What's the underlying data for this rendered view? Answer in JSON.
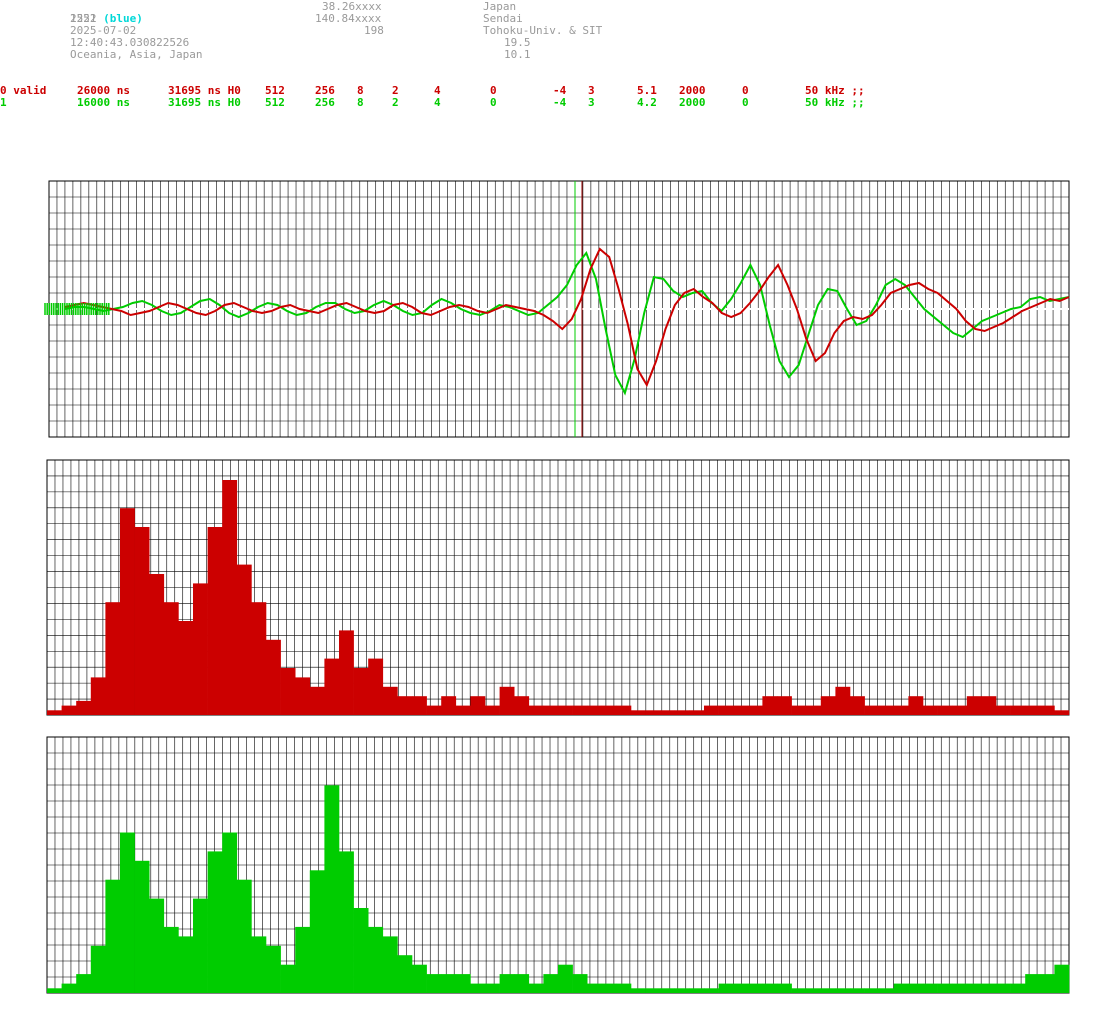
{
  "header": {
    "station_id": "2522",
    "station_color": "(blue)",
    "number": "1251",
    "date": "2025-07-02",
    "time": "12:40:43.030822526",
    "region": "Oceania, Asia, Japan",
    "lat": "38.26xxxx",
    "lon": "140.84xxxx",
    "alt": "198",
    "country": "Japan",
    "city": "Sendai",
    "org": "Tohoku-Univ. & SIT",
    "val1": "19.5",
    "val2": "10.1"
  },
  "channels": [
    {
      "id": "0 valid",
      "c1": "26000 ns",
      "c2": "31695 ns H0",
      "c3": "512",
      "c4": "256",
      "c5": "8",
      "c6": "2",
      "c7": "4",
      "c8": "0",
      "c9": "-4",
      "c10": "3",
      "c11": "5.1",
      "c12": "2000",
      "c13": "0",
      "c14": "50 kHz ;;",
      "color": "#cc0000"
    },
    {
      "id": "1",
      "c1": "16000 ns",
      "c2": "31695 ns H0",
      "c3": "512",
      "c4": "256",
      "c5": "8",
      "c6": "2",
      "c7": "4",
      "c8": "0",
      "c9": "-4",
      "c10": "3",
      "c11": "4.2",
      "c12": "2000",
      "c13": "0",
      "c14": "50 kHz ;;",
      "color": "#00cc00"
    }
  ],
  "chart_data": [
    {
      "type": "line",
      "series": [
        {
          "color": "#cc0000",
          "values": [
            0.1,
            0.2,
            0.3,
            0.2,
            0.1,
            0.0,
            -0.1,
            -0.3,
            -0.2,
            -0.1,
            0.1,
            0.3,
            0.2,
            0.0,
            -0.2,
            -0.3,
            -0.1,
            0.2,
            0.3,
            0.1,
            -0.1,
            -0.2,
            -0.1,
            0.1,
            0.2,
            0.0,
            -0.1,
            -0.2,
            0.0,
            0.2,
            0.3,
            0.1,
            -0.1,
            -0.2,
            -0.1,
            0.2,
            0.3,
            0.1,
            -0.2,
            -0.3,
            -0.1,
            0.1,
            0.2,
            0.1,
            -0.1,
            -0.2,
            0.0,
            0.2,
            0.1,
            0.0,
            -0.1,
            -0.3,
            -0.6,
            -1.0,
            -0.5,
            0.5,
            2.0,
            3.0,
            2.6,
            1.0,
            -0.8,
            -3.0,
            -3.8,
            -2.6,
            -1.0,
            0.2,
            0.8,
            1.0,
            0.6,
            0.3,
            -0.2,
            -0.4,
            -0.2,
            0.3,
            0.9,
            1.6,
            2.2,
            1.2,
            0.0,
            -1.5,
            -2.6,
            -2.2,
            -1.2,
            -0.6,
            -0.4,
            -0.5,
            -0.3,
            0.2,
            0.8,
            1.0,
            1.2,
            1.3,
            1.0,
            0.8,
            0.4,
            0.0,
            -0.6,
            -1.0,
            -1.1,
            -0.9,
            -0.7,
            -0.4,
            -0.1,
            0.1,
            0.3,
            0.5,
            0.4,
            0.6
          ]
        },
        {
          "color": "#00cc00",
          "values": [
            0.0,
            0.1,
            0.1,
            0.0,
            -0.1,
            0.0,
            0.1,
            0.3,
            0.4,
            0.2,
            -0.1,
            -0.3,
            -0.2,
            0.1,
            0.4,
            0.5,
            0.2,
            -0.2,
            -0.4,
            -0.2,
            0.1,
            0.3,
            0.2,
            -0.1,
            -0.3,
            -0.2,
            0.1,
            0.3,
            0.3,
            0.0,
            -0.2,
            -0.1,
            0.2,
            0.4,
            0.2,
            -0.1,
            -0.3,
            -0.2,
            0.2,
            0.5,
            0.3,
            0.0,
            -0.2,
            -0.3,
            -0.1,
            0.2,
            0.1,
            -0.1,
            -0.3,
            -0.2,
            0.2,
            0.6,
            1.2,
            2.2,
            2.8,
            1.5,
            -1.0,
            -3.3,
            -4.2,
            -2.5,
            -0.2,
            1.6,
            1.5,
            0.9,
            0.6,
            0.8,
            0.9,
            0.3,
            -0.1,
            0.5,
            1.3,
            2.2,
            1.2,
            -0.8,
            -2.6,
            -3.4,
            -2.8,
            -1.3,
            0.2,
            1.0,
            0.9,
            0.0,
            -0.8,
            -0.6,
            0.2,
            1.2,
            1.5,
            1.2,
            0.6,
            0.0,
            -0.4,
            -0.8,
            -1.2,
            -1.4,
            -1.0,
            -0.6,
            -0.4,
            -0.2,
            0.0,
            0.1,
            0.5,
            0.6,
            0.4,
            0.5,
            0.6
          ]
        }
      ]
    },
    {
      "type": "bar",
      "color": "#cc0000",
      "values": [
        0.5,
        1,
        1.5,
        4,
        12,
        22,
        20,
        15,
        12,
        10,
        14,
        20,
        25,
        16,
        12,
        8,
        5,
        4,
        3,
        6,
        9,
        5,
        6,
        3,
        2,
        2,
        1,
        2,
        1,
        2,
        1,
        3,
        2,
        1,
        1,
        1,
        1,
        1,
        1,
        1,
        0.5,
        0.5,
        0.5,
        0.5,
        0.5,
        1,
        1,
        1,
        1,
        2,
        2,
        1,
        1,
        2,
        3,
        2,
        1,
        1,
        1,
        2,
        1,
        1,
        1,
        2,
        2,
        1,
        1,
        1,
        1,
        0.5
      ]
    },
    {
      "type": "bar",
      "color": "#00cc00",
      "values": [
        0.5,
        1,
        2,
        5,
        12,
        17,
        14,
        10,
        7,
        6,
        10,
        15,
        17,
        12,
        6,
        5,
        3,
        7,
        13,
        22,
        15,
        9,
        7,
        6,
        4,
        3,
        2,
        2,
        2,
        1,
        1,
        2,
        2,
        1,
        2,
        3,
        2,
        1,
        1,
        1,
        0.5,
        0.5,
        0.5,
        0.5,
        0.5,
        0.5,
        1,
        1,
        1,
        1,
        1,
        0.5,
        0.5,
        0.5,
        0.5,
        0.5,
        0.5,
        0.5,
        1,
        1,
        1,
        1,
        1,
        1,
        1,
        1,
        1,
        2,
        2,
        3
      ]
    }
  ]
}
